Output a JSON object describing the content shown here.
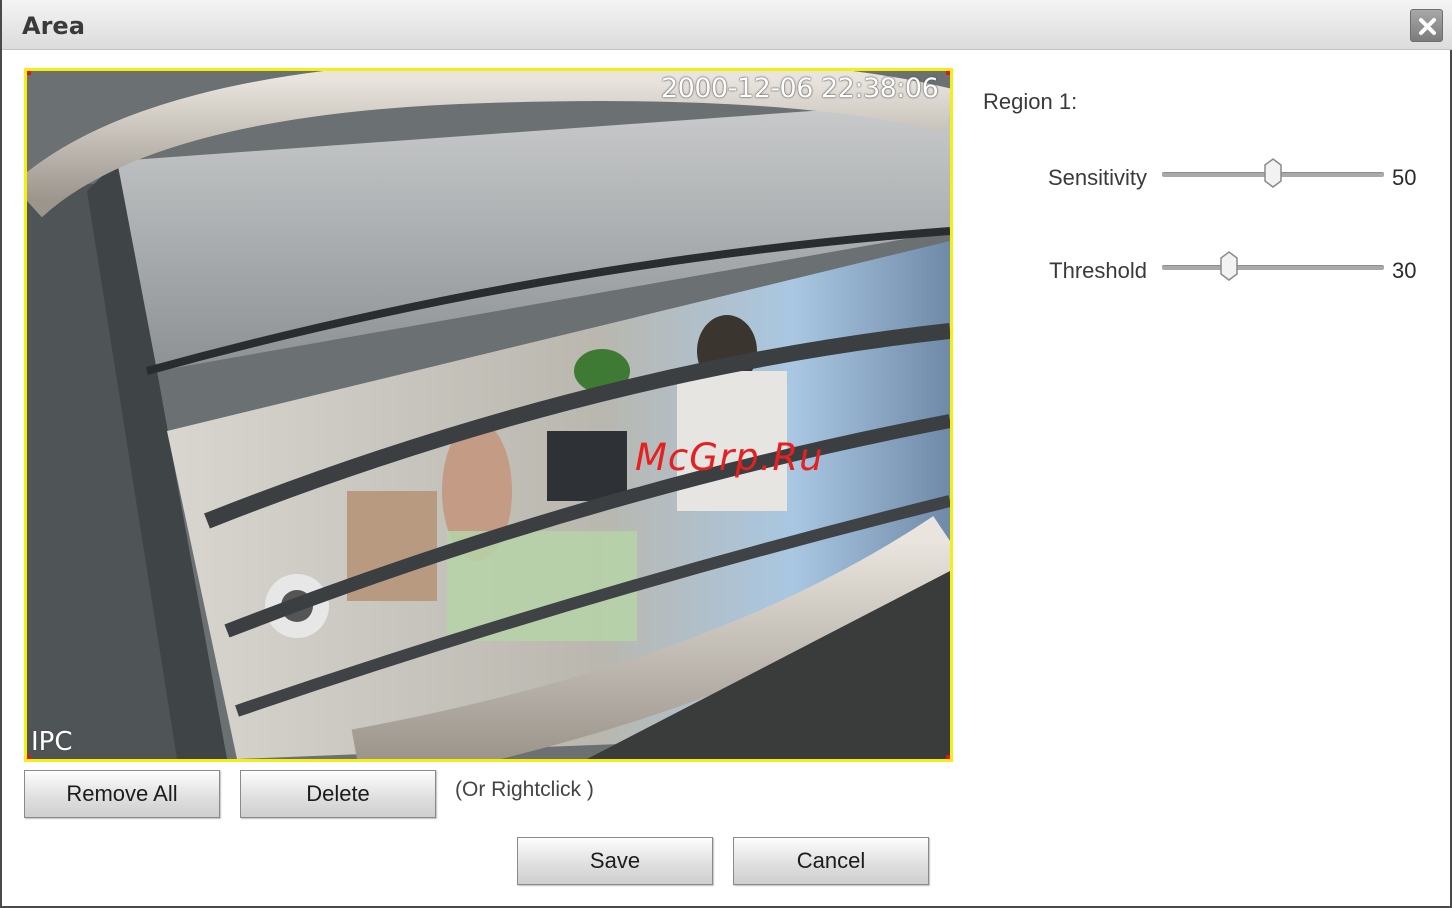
{
  "dialog": {
    "title": "Area",
    "close_icon": "close-icon"
  },
  "video": {
    "timestamp": "2000-12-06 22:38:06",
    "channel_name": "IPC",
    "watermark": "McGrp.Ru",
    "border_color": "#f5ee12"
  },
  "actions": {
    "remove_all_label": "Remove All",
    "delete_label": "Delete",
    "hint": "(Or Rightclick )",
    "save_label": "Save",
    "cancel_label": "Cancel"
  },
  "panel": {
    "region_label": "Region 1:",
    "sliders": [
      {
        "label": "Sensitivity",
        "value": "50",
        "min": 0,
        "max": 100,
        "level": 50
      },
      {
        "label": "Threshold",
        "value": "30",
        "min": 0,
        "max": 100,
        "level": 30
      }
    ]
  }
}
